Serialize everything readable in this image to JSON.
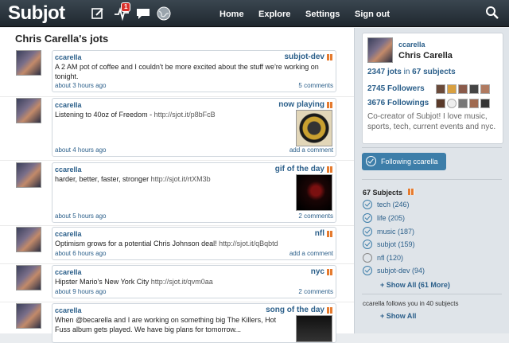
{
  "header": {
    "logo": "Subjot",
    "notification_count": "1",
    "nav": [
      "Home",
      "Explore",
      "Settings",
      "Sign out"
    ]
  },
  "main": {
    "title": "Chris Carella's jots",
    "jots": [
      {
        "user": "ccarella",
        "subject": "subjot-dev",
        "text": "A 2 AM pot of coffee and I couldn't be more excited about the stuff we're working on tonight.",
        "link": "",
        "time": "about 3 hours ago",
        "action": "5 comments"
      },
      {
        "user": "ccarella",
        "subject": "now playing",
        "text": "Listening to 40oz of Freedom - ",
        "link": "http://sjot.it/p8bFcB",
        "time": "about 4 hours ago",
        "action": "add a comment"
      },
      {
        "user": "ccarella",
        "subject": "gif of the day",
        "text": "harder, better, faster, stronger ",
        "link": "http://sjot.it/rtXM3b",
        "time": "about 5 hours ago",
        "action": "2 comments"
      },
      {
        "user": "ccarella",
        "subject": "nfl",
        "text": "Optimism grows for a potential Chris Johnson deal! ",
        "link": "http://sjot.it/qBqbtd",
        "time": "about 6 hours ago",
        "action": "add a comment"
      },
      {
        "user": "ccarella",
        "subject": "nyc",
        "text": "Hipster Mario's New York City ",
        "link": "http://sjot.it/qvm0aa",
        "time": "about 9 hours ago",
        "action": "2 comments"
      },
      {
        "user": "ccarella",
        "subject": "song of the day",
        "text": "When @becarella and I are working on something big The Killers, Hot Fuss album gets played. We have big plans for tomorrow...",
        "link": "",
        "time": "",
        "action": ""
      }
    ]
  },
  "sidebar": {
    "handle": "ccarella",
    "name": "Chris Carella",
    "stats": {
      "jots": "2347 jots",
      "in": "in",
      "subjects": "67 subjects",
      "followers": "2745 Followers",
      "followings": "3676 Followings"
    },
    "bio": "Co-creator of Subjot! I love music, sports, tech, current events and nyc.",
    "follow_label": "Following ccarella",
    "subjects_heading": "67 Subjects",
    "subjects": [
      {
        "label": "tech (246)",
        "checked": true
      },
      {
        "label": "life (205)",
        "checked": true
      },
      {
        "label": "music (187)",
        "checked": true
      },
      {
        "label": "subjot (159)",
        "checked": true
      },
      {
        "label": "nfl (120)",
        "checked": false
      },
      {
        "label": "subjot-dev (94)",
        "checked": true
      }
    ],
    "show_all_subjects": "+ Show All (61 More)",
    "follows_you_text": "ccarella follows you in 40 subjects",
    "show_all_follows": "+ Show All"
  }
}
